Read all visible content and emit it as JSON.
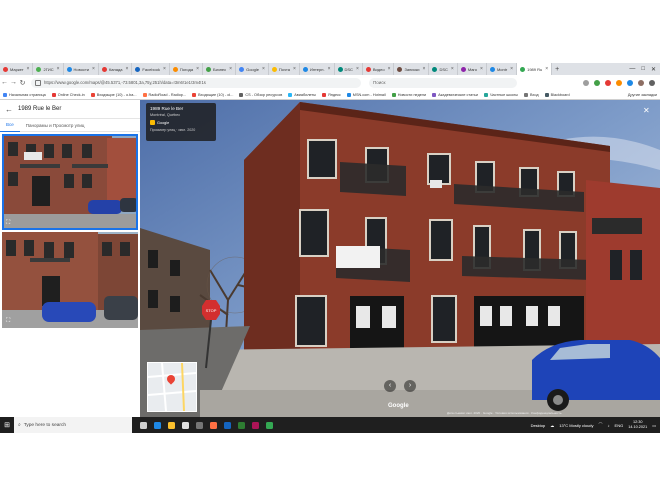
{
  "browser": {
    "tabs": [
      {
        "label": "Маркет",
        "color": "#e53935"
      },
      {
        "label": "2ГИС",
        "color": "#4caf50"
      },
      {
        "label": "Новости",
        "color": "#1e88e5"
      },
      {
        "label": "Канада",
        "color": "#e53935"
      },
      {
        "label": "Facebook",
        "color": "#1565c0"
      },
      {
        "label": "Погода",
        "color": "#fb8c00"
      },
      {
        "label": "Бизнес",
        "color": "#43a047"
      },
      {
        "label": "Google",
        "color": "#4285f4"
      },
      {
        "label": "Почта",
        "color": "#fbbc04"
      },
      {
        "label": "Интерн.",
        "color": "#1e88e5"
      },
      {
        "label": "DSC",
        "color": "#00897b"
      },
      {
        "label": "Видео",
        "color": "#e53935"
      },
      {
        "label": "Записки",
        "color": "#6d4c41"
      },
      {
        "label": "DSC",
        "color": "#00897b"
      },
      {
        "label": "Маго",
        "color": "#8e24aa"
      },
      {
        "label": "Montr",
        "color": "#1e88e5"
      },
      {
        "label": "1989 Ru",
        "color": "#34a853",
        "active": true
      }
    ],
    "new_tab": "+",
    "window_controls": {
      "minimize": "—",
      "maximize": "□",
      "close": "✕"
    },
    "url": "https://www.google.com/maps/@45.5371,-73.5801,3a,75y,251h/data=!3m6!1e1!3m4!1s",
    "search_placeholder": "Поиск"
  },
  "bookmarks": [
    {
      "label": "Начальная страница",
      "color": "#4285f4"
    },
    {
      "label": "Online Check-in",
      "color": "#e53935"
    },
    {
      "label": "Входящие (10) - o.ba...",
      "color": "#ea4335"
    },
    {
      "label": "RadioRoad - Radiop...",
      "color": "#ff7043"
    },
    {
      "label": "Входящие (10) - ol...",
      "color": "#ea4335"
    },
    {
      "label": "CS - Обзор ресурсов",
      "color": "#616161"
    },
    {
      "label": "Авиабилеты",
      "color": "#29b6f6"
    },
    {
      "label": "Яндекс",
      "color": "#e53935"
    },
    {
      "label": "MSN.com - Hotmail",
      "color": "#1e88e5"
    },
    {
      "label": "Новости недели",
      "color": "#43a047"
    },
    {
      "label": "Академические статьи",
      "color": "#7e57c2"
    },
    {
      "label": "Частные школы",
      "color": "#26a69a"
    },
    {
      "label": "Вход",
      "color": "#757575"
    },
    {
      "label": "Blackboard",
      "color": "#455a64"
    }
  ],
  "bookmarks_other": "Другие закладки",
  "sidepanel": {
    "title": "1989 Rue le Ber",
    "tabs": [
      {
        "label": "Все",
        "active": true
      },
      {
        "label": "Панорамы и Просмотр улиц",
        "active": false
      }
    ]
  },
  "streetview": {
    "card_title": "1989 Rue le Ber",
    "card_subtitle": "Montréal, Québec",
    "card_provider": "Google",
    "card_capture": "Просмотр улиц · июл. 2020",
    "google_mark": "Google",
    "terms": "Дата съемки: июл. 2020 · Google · Условия использования · Конфиденциальность"
  },
  "taskbar": {
    "search_placeholder": "Type here to search",
    "desktop_label": "Desktop",
    "weather": "13°C Mostly cloudy",
    "language": "ENG",
    "time": "12:30",
    "date": "14.10.2021"
  }
}
